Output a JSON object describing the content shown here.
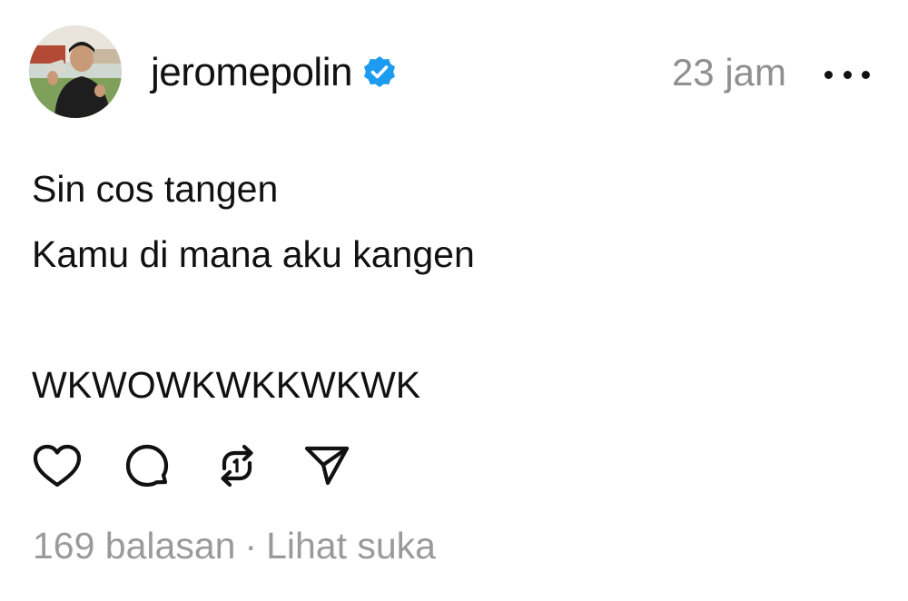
{
  "post": {
    "username": "jeromepolin",
    "verified_icon": "verified-badge-icon",
    "timestamp": "23 jam",
    "more_icon": "more-options-icon",
    "lines": [
      "Sin cos tangen",
      "Kamu di mana aku kangen",
      "",
      "WKWOWKWKKWKWK"
    ],
    "actions": {
      "like_icon": "heart-icon",
      "reply_icon": "comment-icon",
      "repost_icon": "repost-icon",
      "share_icon": "send-icon"
    },
    "footer": {
      "replies": "169 balasan",
      "separator": "·",
      "likes_link": "Lihat suka"
    },
    "colors": {
      "text": "#111111",
      "muted": "#8f8f8f",
      "verified": "#1d9bf0"
    }
  }
}
